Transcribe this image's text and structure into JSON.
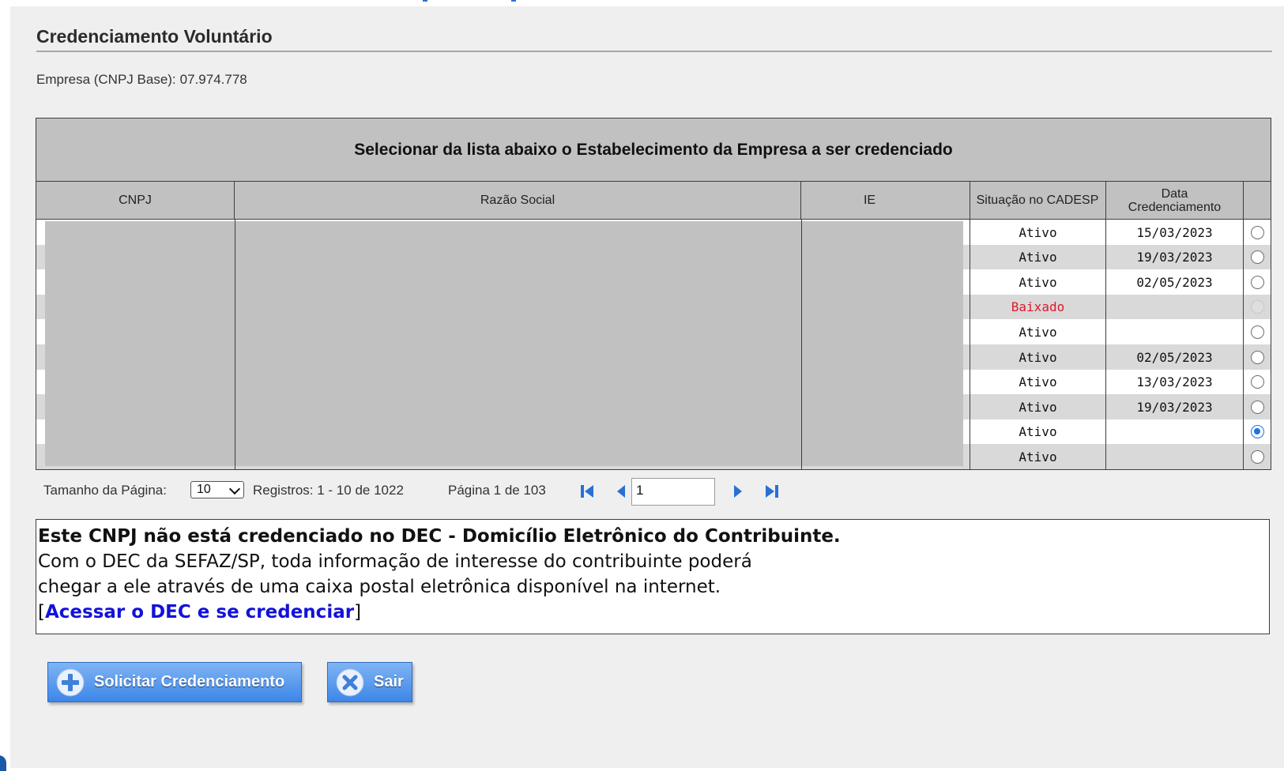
{
  "section": {
    "title": "Credenciamento Voluntário",
    "cnpj_base_label": "Empresa (CNPJ Base):",
    "cnpj_base_value": "07.974.778"
  },
  "grid": {
    "caption": "Selecionar da lista abaixo o Estabelecimento da Empresa a ser credenciado",
    "columns": {
      "cnpj": "CNPJ",
      "razao_social": "Razão Social",
      "ie": "IE",
      "situacao": "Situação no CADESP",
      "data_line1": "Data",
      "data_line2": "Credenciamento"
    },
    "rows": [
      {
        "situacao": "Ativo",
        "data": "15/03/2023",
        "radio": "unchecked"
      },
      {
        "situacao": "Ativo",
        "data": "19/03/2023",
        "radio": "unchecked"
      },
      {
        "situacao": "Ativo",
        "data": "02/05/2023",
        "radio": "unchecked"
      },
      {
        "situacao": "Baixado",
        "data": "",
        "radio": "disabled"
      },
      {
        "situacao": "Ativo",
        "data": "",
        "radio": "unchecked"
      },
      {
        "situacao": "Ativo",
        "data": "02/05/2023",
        "radio": "unchecked"
      },
      {
        "situacao": "Ativo",
        "data": "13/03/2023",
        "radio": "unchecked"
      },
      {
        "situacao": "Ativo",
        "data": "19/03/2023",
        "radio": "unchecked"
      },
      {
        "situacao": "Ativo",
        "data": "",
        "radio": "checked"
      },
      {
        "situacao": "Ativo",
        "data": "",
        "radio": "unchecked"
      }
    ]
  },
  "pager": {
    "page_size_label": "Tamanho da Página:",
    "page_size_value": "10",
    "records": "Registros: 1 - 10 de 1022",
    "page_info": "Página 1 de 103",
    "current_page": "1"
  },
  "dec_notice": {
    "headline": "Este CNPJ não está credenciado no DEC - Domicílio Eletrônico do Contribuinte.",
    "line1": "Com o DEC da SEFAZ/SP, toda informação de interesse do contribuinte poderá",
    "line2": "chegar a ele através de uma caixa postal eletrônica disponível na internet.",
    "bracket_open": "[",
    "link_text": "Acessar o DEC e se credenciar",
    "bracket_close": "]"
  },
  "buttons": {
    "solicitar": "Solicitar Credenciamento",
    "sair": "Sair"
  },
  "colors": {
    "accent": "#1a73e8",
    "status_baixado": "#e0182b",
    "link": "#1212d8",
    "button_blue": "#3d86e8"
  }
}
